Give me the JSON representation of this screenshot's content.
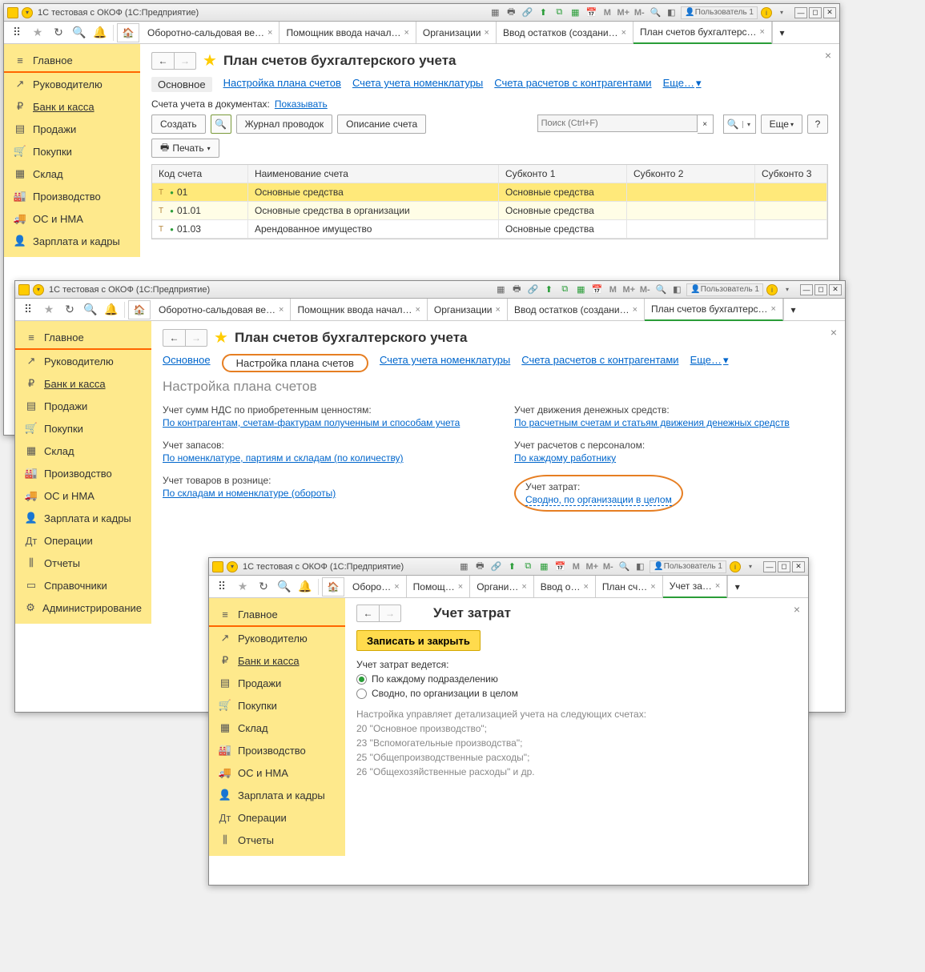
{
  "window_title": "1С тестовая с ОКОФ  (1С:Предприятие)",
  "user_label": "Пользователь 1",
  "titlebar_m": [
    "M",
    "M+",
    "M-"
  ],
  "tabs_top": [
    "Оборотно-сальдовая ве…",
    "Помощник ввода начал…",
    "Организации",
    "Ввод остатков (создани…",
    "План счетов бухгалтерс…"
  ],
  "sidebar": [
    {
      "icon": "≡",
      "label": "Главное",
      "active": true
    },
    {
      "icon": "↗",
      "label": "Руководителю"
    },
    {
      "icon": "₽",
      "label": "Банк и касса",
      "link": true
    },
    {
      "icon": "▤",
      "label": "Продажи"
    },
    {
      "icon": "🛒",
      "label": "Покупки"
    },
    {
      "icon": "▦",
      "label": "Склад"
    },
    {
      "icon": "🏭",
      "label": "Производство"
    },
    {
      "icon": "🚚",
      "label": "ОС и НМА"
    },
    {
      "icon": "👤",
      "label": "Зарплата и кадры"
    },
    {
      "icon": "Дт",
      "label": "Операции"
    },
    {
      "icon": "⫼",
      "label": "Отчеты"
    },
    {
      "icon": "▭",
      "label": "Справочники"
    },
    {
      "icon": "⚙",
      "label": "Администрирование"
    }
  ],
  "page1": {
    "title": "План счетов бухгалтерского учета",
    "subtabs": [
      "Основное",
      "Настройка плана счетов",
      "Счета учета номенклатуры",
      "Счета расчетов с контрагентами",
      "Еще…"
    ],
    "subtab_active": 0,
    "doc_label": "Счета учета в документах:",
    "doc_link": "Показывать",
    "btns": {
      "create": "Создать",
      "journal": "Журнал проводок",
      "desc": "Описание счета",
      "print": "Печать",
      "search_ph": "Поиск (Ctrl+F)",
      "more": "Еще",
      "help": "?"
    },
    "cols": [
      "Код счета",
      "Наименование счета",
      "Субконто 1",
      "Субконто 2",
      "Субконто 3"
    ],
    "rows": [
      {
        "code": "01",
        "name": "Основные средства",
        "s1": "Основные средства",
        "sel": true
      },
      {
        "code": "01.01",
        "name": "Основные средства в организации",
        "s1": "Основные средства",
        "alt": true
      },
      {
        "code": "01.03",
        "name": "Арендованное имущество",
        "s1": "Основные средства"
      }
    ]
  },
  "page2": {
    "title": "План счетов бухгалтерского учета",
    "subtabs": [
      "Основное",
      "Настройка плана счетов",
      "Счета учета номенклатуры",
      "Счета расчетов с контрагентами",
      "Еще…"
    ],
    "subtab_active": 1,
    "section_title": "Настройка плана счетов",
    "left": [
      {
        "label": "Учет сумм НДС по приобретенным ценностям:",
        "link": "По контрагентам, счетам-фактурам полученным и способам учета"
      },
      {
        "label": "Учет запасов:",
        "link": "По номенклатуре, партиям и складам (по количеству)"
      },
      {
        "label": "Учет товаров в рознице:",
        "link": "По складам и номенклатуре (обороты)"
      }
    ],
    "right": [
      {
        "label": "Учет движения денежных средств:",
        "link": "По расчетным счетам и статьям движения денежных средств"
      },
      {
        "label": "Учет расчетов с персоналом:",
        "link": "По каждому работнику"
      },
      {
        "label": "Учет затрат:",
        "link": "Сводно, по организации в целом",
        "dotted": true,
        "hl": true
      }
    ]
  },
  "page3": {
    "tabs": [
      "Оборо…",
      "Помощ…",
      "Органи…",
      "Ввод о…",
      "План сч…",
      "Учет за…"
    ],
    "title": "Учет затрат",
    "save_btn": "Записать и закрыть",
    "radio_label": "Учет затрат ведется:",
    "radio_options": [
      "По каждому подразделению",
      "Сводно, по организации в целом"
    ],
    "note_lines": [
      "Настройка управляет детализацией учета на следующих счетах:",
      "20 \"Основное производство\";",
      "23 \"Вспомогательные производства\";",
      "25 \"Общепроизводственные расходы\";",
      "26 \"Общехозяйственные расходы\" и др."
    ]
  }
}
